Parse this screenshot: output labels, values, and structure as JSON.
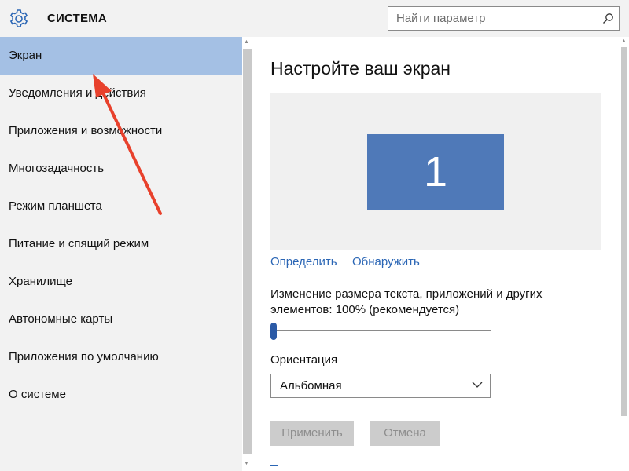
{
  "header": {
    "title": "СИСТЕМА",
    "search_placeholder": "Найти параметр",
    "icon": "gear-icon"
  },
  "sidebar": {
    "items": [
      {
        "label": "Экран",
        "active": true
      },
      {
        "label": "Уведомления и действия"
      },
      {
        "label": "Приложения и возможности"
      },
      {
        "label": "Многозадачность"
      },
      {
        "label": "Режим планшета"
      },
      {
        "label": "Питание и спящий режим"
      },
      {
        "label": "Хранилище"
      },
      {
        "label": "Автономные карты"
      },
      {
        "label": "Приложения по умолчанию"
      },
      {
        "label": "О системе"
      }
    ]
  },
  "main": {
    "title": "Настройте ваш экран",
    "monitor_number": "1",
    "identify_link": "Определить",
    "detect_link": "Обнаружить",
    "scale_label": "Изменение размера текста, приложений и других элементов: 100% (рекомендуется)",
    "scale_value_percent": 100,
    "orientation_label": "Ориентация",
    "orientation_value": "Альбомная",
    "apply_button": "Применить",
    "cancel_button": "Отмена"
  },
  "colors": {
    "accent": "#2b66b5",
    "active_item": "#a4c0e4",
    "monitor": "#4f79b8",
    "annotation_arrow": "#e8412c"
  }
}
